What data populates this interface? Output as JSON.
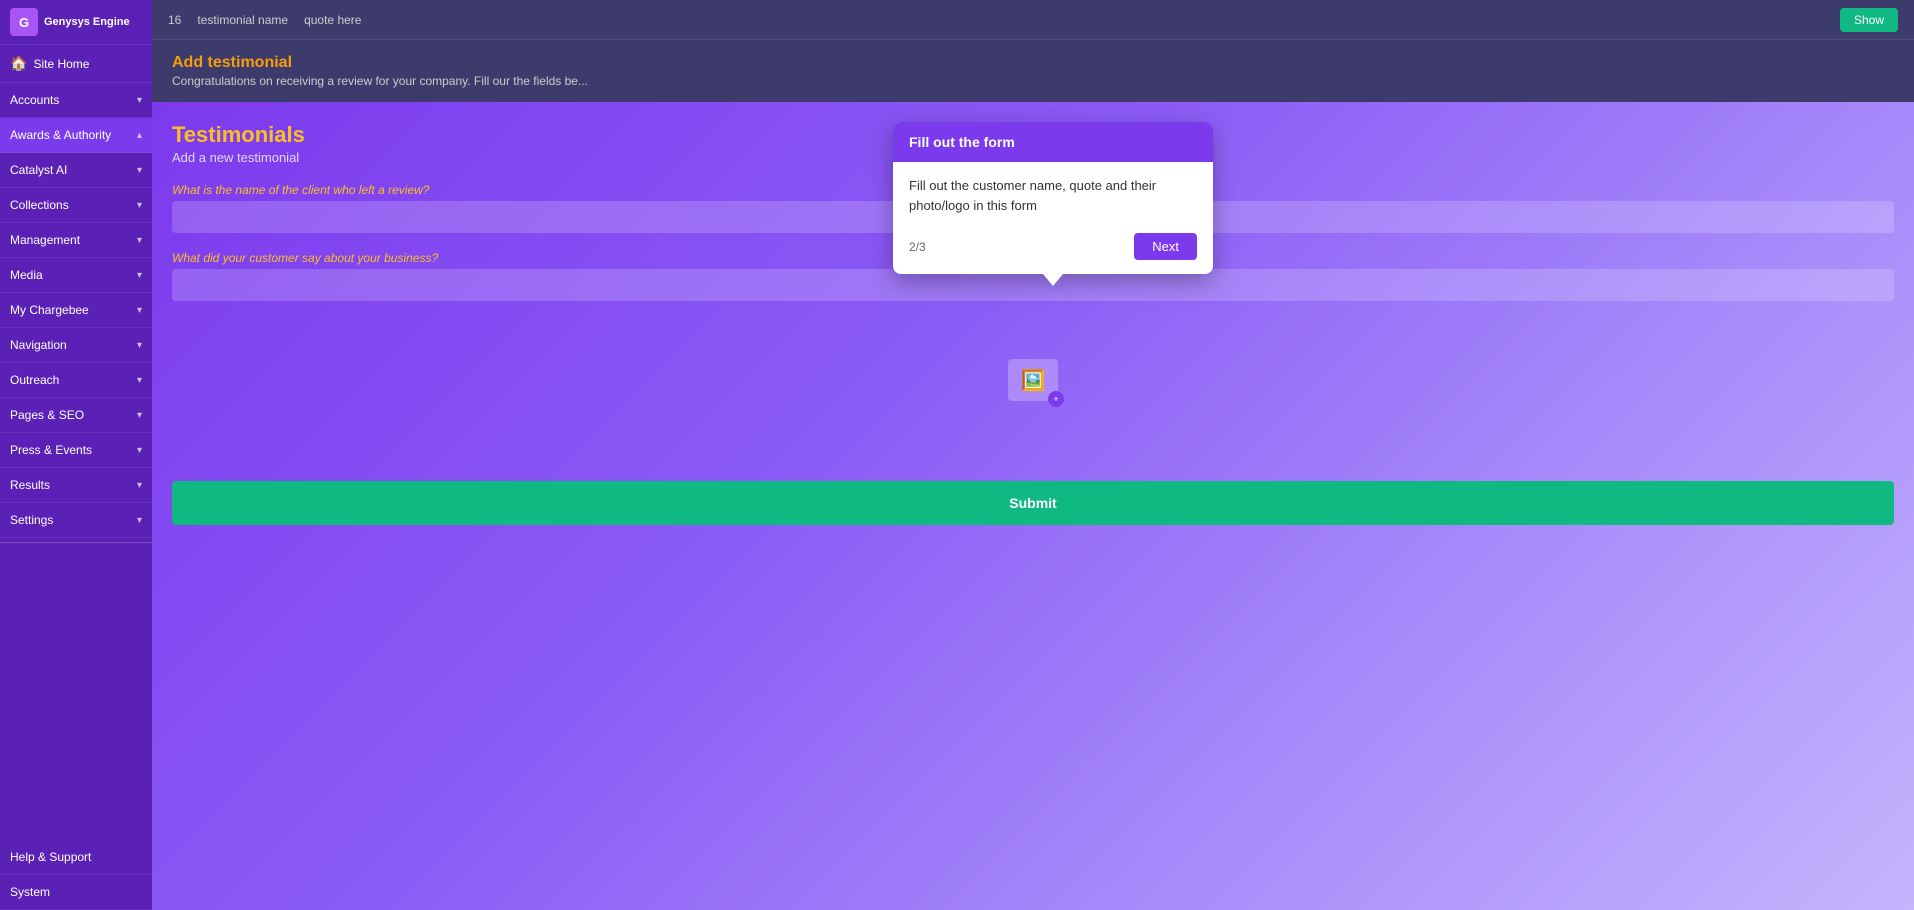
{
  "sidebar": {
    "logo_icon": "G",
    "logo_text": "Genysys Engine",
    "home_label": "Site Home",
    "items": [
      {
        "id": "accounts",
        "label": "Accounts",
        "active": false
      },
      {
        "id": "awards-authority",
        "label": "Awards & Authority",
        "active": true
      },
      {
        "id": "catalyst-ai",
        "label": "Catalyst AI",
        "active": false
      },
      {
        "id": "collections",
        "label": "Collections",
        "active": false
      },
      {
        "id": "management",
        "label": "Management",
        "active": false
      },
      {
        "id": "media",
        "label": "Media",
        "active": false
      },
      {
        "id": "my-chargebee",
        "label": "My Chargebee",
        "active": false
      },
      {
        "id": "navigation",
        "label": "Navigation",
        "active": false
      },
      {
        "id": "outreach",
        "label": "Outreach",
        "active": false
      },
      {
        "id": "pages-seo",
        "label": "Pages & SEO",
        "active": false
      },
      {
        "id": "press-events",
        "label": "Press & Events",
        "active": false
      },
      {
        "id": "results",
        "label": "Results",
        "active": false
      },
      {
        "id": "settings",
        "label": "Settings",
        "active": false
      }
    ],
    "bottom_items": [
      {
        "id": "help-support",
        "label": "Help & Support"
      },
      {
        "id": "system",
        "label": "System"
      }
    ]
  },
  "top_bar": {
    "row_num": "16",
    "testimonial_name": "testimonial name",
    "quote": "quote here",
    "show_button_label": "Show"
  },
  "page_header": {
    "title": "Add testimonial",
    "subtitle": "Congratulations on receiving a review for your company. Fill our the fields be..."
  },
  "form": {
    "section_title": "Testimonials",
    "section_sub": "Add a new testimonial",
    "client_name_label": "What is the name of the client who left a review?",
    "client_name_placeholder": "",
    "customer_quote_label": "What did your customer say about your business?",
    "customer_quote_placeholder": "",
    "submit_label": "Submit"
  },
  "tooltip": {
    "header": "Fill out the form",
    "body": "Fill out the customer name, quote and their photo/logo in this form",
    "step": "2/3",
    "next_label": "Next"
  }
}
